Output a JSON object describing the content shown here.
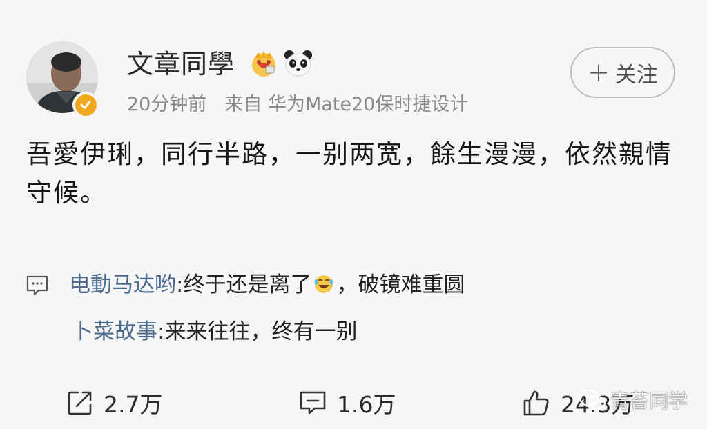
{
  "post": {
    "author": {
      "name": "文章同學",
      "badges": [
        "crown-badge-icon",
        "panda-emoji-icon"
      ],
      "verified": true
    },
    "timestamp": "20分钟前",
    "source": "来自 华为Mate20保时捷设计",
    "follow_label": "关注",
    "text": "吾愛伊琍，同行半路，一别两宽，餘生漫漫，依然親情守候。"
  },
  "comments": [
    {
      "author": "电動马达哟",
      "separator": ":",
      "content_before_emoji": "终于还是离了",
      "emoji": "laughing-emoji-icon",
      "content_after_emoji": "，破镜难重圆"
    },
    {
      "author": "卜菜故事",
      "separator": ":",
      "content": "来来往往，终有一别"
    }
  ],
  "actions": {
    "repost_count": "2.7万",
    "comment_count": "1.6万",
    "like_count": "24.3万"
  },
  "watermark": {
    "text": "青苔同学",
    "icon": "wechat-icon"
  },
  "colors": {
    "background": "#f6f6f6",
    "comment_author": "#4a6a8e",
    "meta_text": "#8a8a8a",
    "verified_gold": "#f2a81d"
  }
}
